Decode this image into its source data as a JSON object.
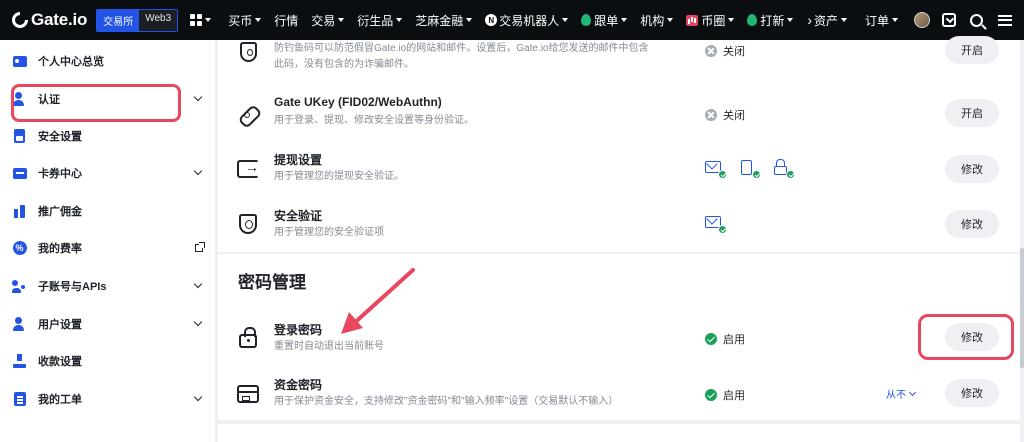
{
  "header": {
    "logo": "Gate.io",
    "segment": [
      "交易所",
      "Web3"
    ],
    "nav": [
      {
        "label": "买币",
        "caret": true
      },
      {
        "label": "行情",
        "caret": false
      },
      {
        "label": "交易",
        "caret": true
      },
      {
        "label": "衍生品",
        "caret": true
      },
      {
        "label": "芝麻金融",
        "caret": true
      },
      {
        "label": "交易机器人",
        "caret": true,
        "icon": "n-logo-icon"
      },
      {
        "label": "跟单",
        "caret": true,
        "icon": "drop-icon"
      },
      {
        "label": "机构",
        "caret": true
      },
      {
        "label": "币圈",
        "caret": true,
        "icon": "bar-chart-icon"
      },
      {
        "label": "打新",
        "caret": true,
        "icon": "drop-icon"
      }
    ],
    "right": {
      "assets": "资产",
      "orders": "订单"
    }
  },
  "sidebar": {
    "items": [
      {
        "label": "个人中心总览",
        "icon": "id-card-icon",
        "suffix": "none"
      },
      {
        "label": "认证",
        "icon": "user-verify-icon",
        "suffix": "chevron"
      },
      {
        "label": "安全设置",
        "icon": "security-doc-icon",
        "suffix": "none"
      },
      {
        "label": "卡券中心",
        "icon": "ticket-icon",
        "suffix": "chevron"
      },
      {
        "label": "推广佣金",
        "icon": "commission-icon",
        "suffix": "none"
      },
      {
        "label": "我的费率",
        "icon": "percent-icon",
        "suffix": "external"
      },
      {
        "label": "子账号与APIs",
        "icon": "sub-account-icon",
        "suffix": "chevron"
      },
      {
        "label": "用户设置",
        "icon": "user-settings-icon",
        "suffix": "chevron"
      },
      {
        "label": "收款设置",
        "icon": "payment-icon",
        "suffix": "none"
      },
      {
        "label": "我的工单",
        "icon": "ticket-doc-icon",
        "suffix": "chevron"
      }
    ]
  },
  "security": {
    "rows": [
      {
        "title": "",
        "desc": "防钓鱼码可以防范假冒Gate.io的网站和邮件。设置后，Gate.io给您发送的邮件中包含\n此码，没有包含的为诈骗邮件。",
        "status": "关闭",
        "button": "开启",
        "icon": "anti-phishing-shield-icon"
      },
      {
        "title": "Gate UKey (FID02/WebAuthn)",
        "desc": "用于登录、提现、修改安全设置等身份验证。",
        "status": "关闭",
        "button": "开启",
        "icon": "ukey-icon"
      },
      {
        "title": "提现设置",
        "desc": "用于管理您的提现安全验证。",
        "status": "",
        "button": "修改",
        "icon": "withdraw-icon"
      },
      {
        "title": "安全验证",
        "desc": "用于管理您的安全验证项",
        "status": "",
        "button": "修改",
        "icon": "security-verify-icon"
      }
    ]
  },
  "password": {
    "title": "密码管理",
    "rows": [
      {
        "title": "登录密码",
        "desc": "重置时自动退出当前账号",
        "status": "启用",
        "button": "修改",
        "icon": "lock-icon"
      },
      {
        "title": "资金密码",
        "desc": "用于保护资金安全，支持修改\"资金密码\"和\"输入频率\"设置（交易默认不输入）",
        "status": "启用",
        "button": "修改",
        "frequency": "从不",
        "icon": "fund-password-icon"
      }
    ]
  },
  "colors": {
    "accent": "#2354e6",
    "highlight": "#e8475f",
    "success": "#19a05a",
    "topbar": "#0b0e11"
  }
}
